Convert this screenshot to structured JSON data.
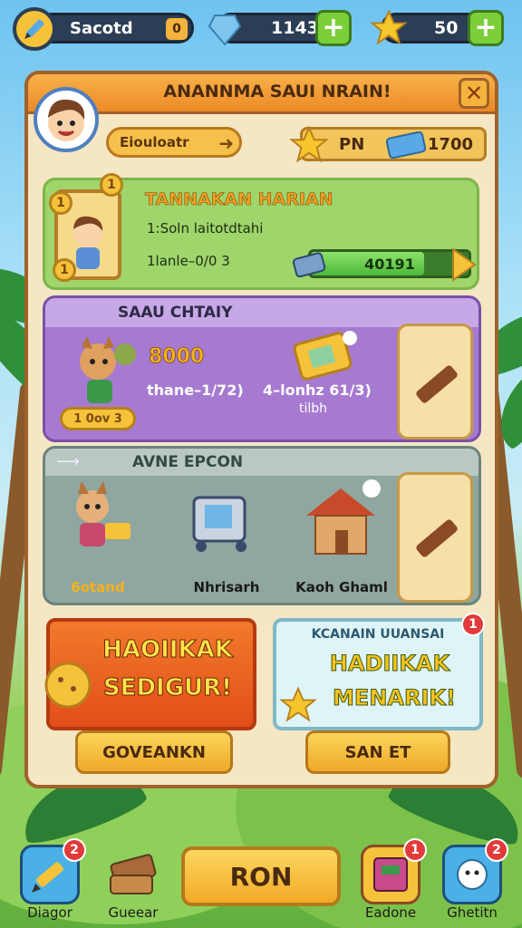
{
  "topbar": {
    "player_name": "Sacotd",
    "player_level": "0",
    "gems": "1143",
    "stars": "50",
    "plus_symbol": "+"
  },
  "panel": {
    "title": "ANANNMA SAUI NRAIN!",
    "close_symbol": "✕",
    "name_pill": "Eiouloatr",
    "name_arrow": "➜",
    "resource_label": "PN",
    "resource_value": "1700"
  },
  "task_card": {
    "title": "TANNAKAN HARIAN",
    "line1": "1:Soln laitotdtahi",
    "line2": "1lanle–0/0 3",
    "progress_text": "40191",
    "progress_fraction": 0.72,
    "coin_symbol": "1"
  },
  "shop_card": {
    "title": "SAAU CHTAIY",
    "price": "8000",
    "item1_label": "thane–1/72)",
    "item2_label": "4–lonhz 61/3)",
    "item2_sub": "tilbh",
    "coin_tag": "1 0ov 3"
  },
  "event_card": {
    "title": "AVNE EPCON",
    "items": [
      {
        "label": "6otand"
      },
      {
        "label": "Nhrisarh"
      },
      {
        "label": "Kaoh Ghaml"
      }
    ]
  },
  "banner_left": {
    "line1": "HAOIIKAK",
    "line2": "SEDIGUR!",
    "button": "GOVEANKN"
  },
  "banner_right": {
    "header": "KCANAIN UUANSAI",
    "line1": "HADIIKAK",
    "line2": "MENARIK!",
    "badge": "1",
    "button": "SAN ET"
  },
  "bottom_nav": {
    "items": [
      {
        "label": "Diagor",
        "badge": "2"
      },
      {
        "label": "Gueear",
        "badge": ""
      },
      {
        "label": "Eadone",
        "badge": "1"
      },
      {
        "label": "Ghetitn",
        "badge": "2"
      }
    ],
    "center_button": "RON"
  },
  "colors": {
    "accent_orange": "#ec8a25",
    "panel_bg": "#f5e6c4",
    "green_card": "#9fd56a",
    "purple_card": "#a67ad0",
    "gray_card": "#8fa7a0"
  }
}
